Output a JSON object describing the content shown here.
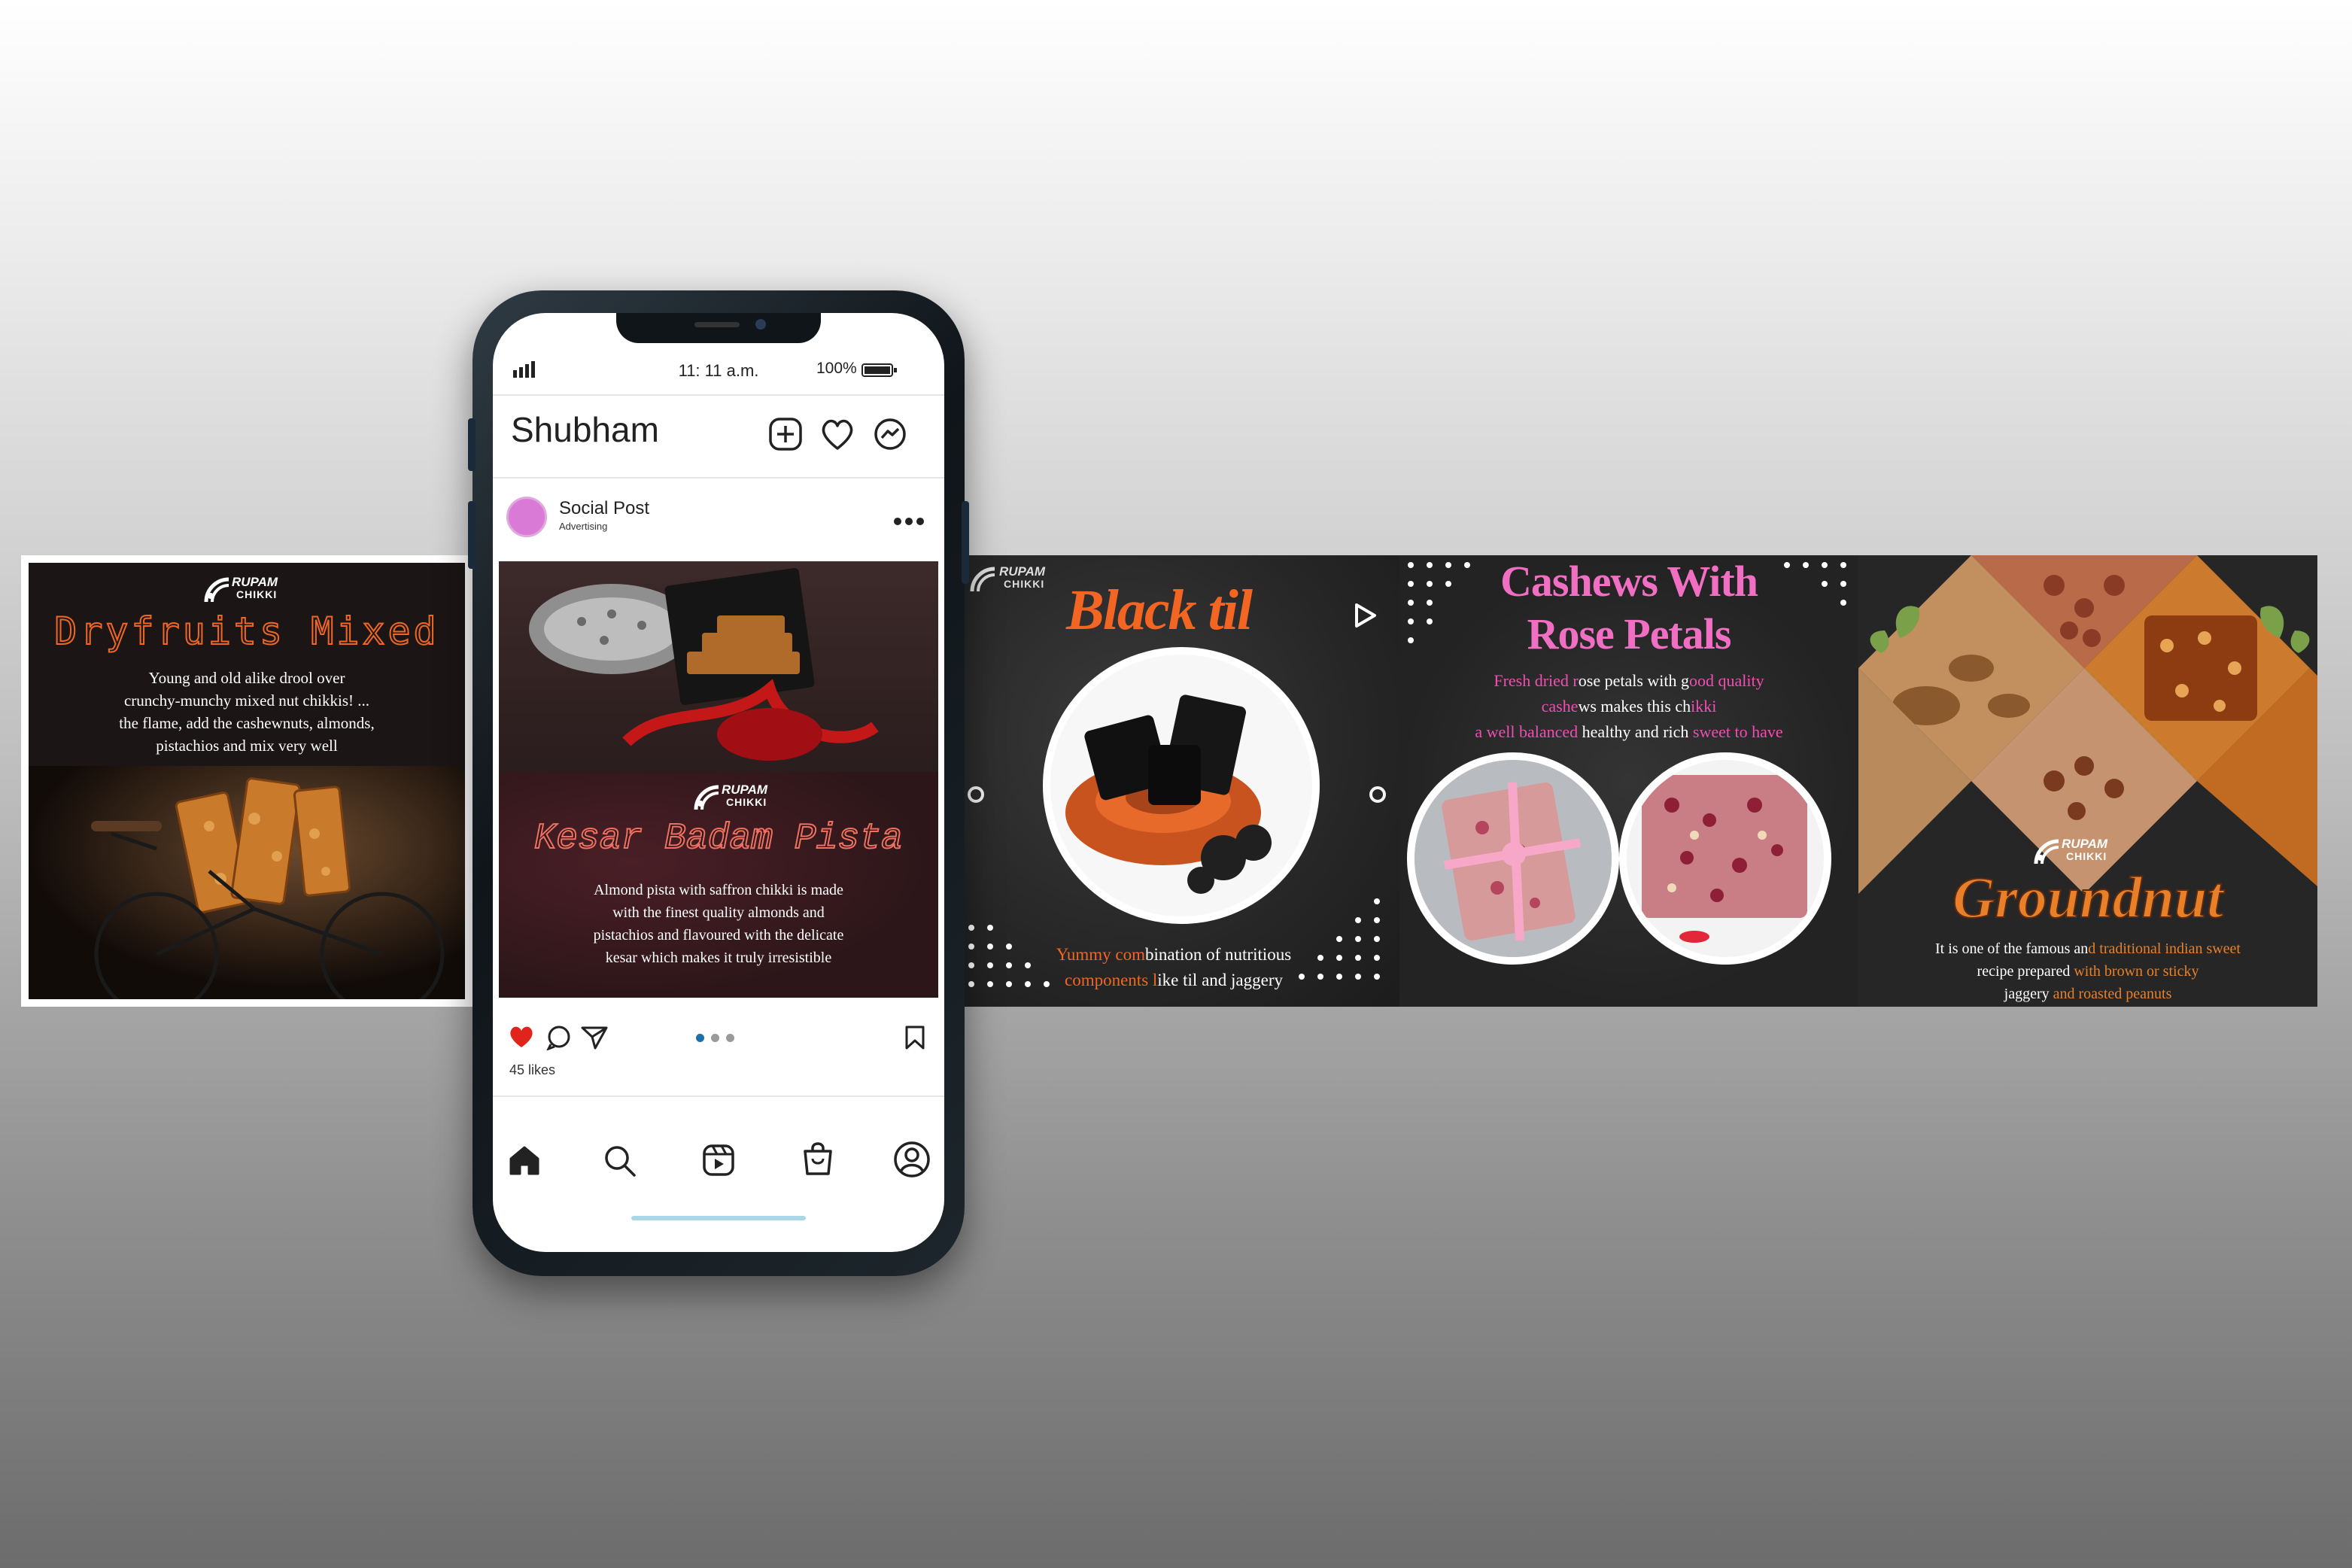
{
  "left_card": {
    "brand_top": "RUPAM",
    "brand_bottom": "CHIKKI",
    "title": "Dryfruits Mixed",
    "lines": [
      "Young and old alike drool over",
      "crunchy-munchy mixed nut chikkis! ...",
      "the flame, add the cashewnuts, almonds,",
      "pistachios and mix very well"
    ]
  },
  "phone": {
    "status": {
      "time": "11: 11 a.m.",
      "battery": "100%"
    },
    "header": {
      "username": "Shubham"
    },
    "post": {
      "account": "Social Post",
      "subtitle": "Advertising",
      "brand_top": "RUPAM",
      "brand_bottom": "CHIKKI",
      "title": "Kesar Badam Pista",
      "lines": [
        "Almond pista with saffron chikki is made",
        "with the finest quality almonds and",
        "pistachios and flavoured with the delicate",
        "kesar which makes it truly irresistible"
      ],
      "likes": "45 likes"
    },
    "icons": {
      "signal": "signal-icon",
      "battery": "battery-icon",
      "new_post": "plus-square-icon",
      "heart": "heart-icon",
      "messenger": "messenger-icon",
      "more": "more-icon",
      "like": "heart-filled-icon",
      "comment": "comment-icon",
      "share": "send-icon",
      "save": "bookmark-icon",
      "home": "home-icon",
      "search": "search-icon",
      "reels": "reels-icon",
      "shop": "shop-icon",
      "profile": "profile-icon"
    }
  },
  "blacktil": {
    "brand_top": "RUPAM",
    "brand_bottom": "CHIKKI",
    "title": "Black til",
    "caption_line1_a": "Yummy com",
    "caption_line1_b": "bination of nutritious",
    "caption_line2_a": "components l",
    "caption_line2_b": "ike til and jaggery"
  },
  "cashew": {
    "title_line1": "Cashews With",
    "title_line2": "Rose Petals",
    "l1_a": "Fresh dried r",
    "l1_b": "ose petals with g",
    "l1_c": "ood quality",
    "l2_a": "cashe",
    "l2_b": "ws makes this ch",
    "l2_c": "ikki",
    "l3_a": "a well balanced ",
    "l3_b": "healthy and rich ",
    "l3_c": "sweet to have"
  },
  "groundnut": {
    "brand_top": "RUPAM",
    "brand_bottom": "CHIKKI",
    "title": "Groundnut",
    "l1_a": "It is one of the famous an",
    "l1_b": "d traditional indian sweet",
    "l2_a": "recipe prepared ",
    "l2_b": "with brown or sticky",
    "l3_a": "jaggery ",
    "l3_b": "and roasted peanuts"
  },
  "colors": {
    "accent_orange": "#f26522",
    "accent_pink": "#ef4fb3",
    "heart_red": "#e0231b",
    "carousel_active": "#1f6fa8"
  }
}
